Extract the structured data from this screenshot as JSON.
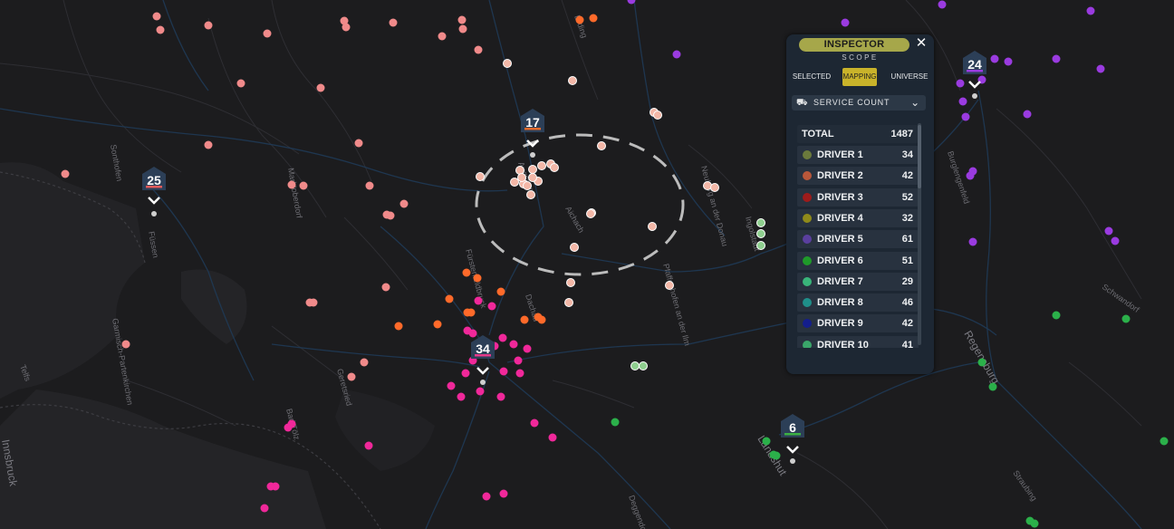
{
  "map": {
    "place_labels": [
      {
        "text": "Regensburg",
        "cls": "city"
      },
      {
        "text": "Landshut",
        "cls": "city"
      },
      {
        "text": "Innsbruck",
        "cls": "city"
      },
      {
        "text": "Garmisch-Partenkirchen",
        "cls": "maplabel"
      },
      {
        "text": "Geretsried",
        "cls": "maplabel"
      },
      {
        "text": "Bad Tölz",
        "cls": "maplabel"
      },
      {
        "text": "Fürstenfeldbruck",
        "cls": "maplabel"
      },
      {
        "text": "Dachau",
        "cls": "maplabel"
      },
      {
        "text": "Pfaffenhofen an der Ilm",
        "cls": "maplabel"
      },
      {
        "text": "Ingolstadt",
        "cls": "maplabel"
      },
      {
        "text": "Neuburg an der Donau",
        "cls": "maplabel"
      },
      {
        "text": "Burglengenfeld",
        "cls": "maplabel"
      },
      {
        "text": "Schwandorf",
        "cls": "maplabel"
      },
      {
        "text": "Straubing",
        "cls": "maplabel"
      },
      {
        "text": "Erding",
        "cls": "maplabel"
      },
      {
        "text": "Deggendorf",
        "cls": "maplabel"
      },
      {
        "text": "Aichach",
        "cls": "maplabel"
      },
      {
        "text": "Augsburg",
        "cls": "maplabel"
      },
      {
        "text": "Füssen",
        "cls": "maplabel"
      },
      {
        "text": "Marktoberdorf",
        "cls": "maplabel"
      },
      {
        "text": "Sonthofen",
        "cls": "maplabel"
      },
      {
        "text": "Telfs",
        "cls": "maplabel"
      }
    ],
    "cluster_markers": [
      {
        "count": "25",
        "color": "#e55b5b"
      },
      {
        "count": "17",
        "color": "#e66b2c"
      },
      {
        "count": "34",
        "color": "#e6398a"
      },
      {
        "count": "6",
        "color": "#3cb043"
      },
      {
        "count": "24",
        "color": "#9a3be0"
      }
    ],
    "marker_icon": "chevron-down-icon",
    "selection_ring": "dashed-circle"
  },
  "inspector": {
    "title": "INSPECTOR",
    "scope_label": "SCOPE",
    "close_icon": "close-icon",
    "tabs": [
      {
        "label": "SELECTED",
        "active": false
      },
      {
        "label": "MAPPING",
        "active": true
      },
      {
        "label": "UNIVERSE",
        "active": false
      }
    ],
    "metric": {
      "label": "SERVICE COUNT",
      "icon": "truck-icon",
      "dropdown_icon": "chevron-down-icon"
    },
    "total": {
      "label": "TOTAL",
      "value": "1487"
    },
    "drivers": [
      {
        "name": "DRIVER 1",
        "value": "34",
        "color": "#6b7a3c"
      },
      {
        "name": "DRIVER 2",
        "value": "42",
        "color": "#b8573a"
      },
      {
        "name": "DRIVER 3",
        "value": "52",
        "color": "#9e1b1b"
      },
      {
        "name": "DRIVER 4",
        "value": "32",
        "color": "#8f8a1a"
      },
      {
        "name": "DRIVER 5",
        "value": "61",
        "color": "#5a3f9e"
      },
      {
        "name": "DRIVER 6",
        "value": "51",
        "color": "#1f9a2a"
      },
      {
        "name": "DRIVER 7",
        "value": "29",
        "color": "#39b57a"
      },
      {
        "name": "DRIVER 8",
        "value": "46",
        "color": "#1f8f8a"
      },
      {
        "name": "DRIVER 9",
        "value": "42",
        "color": "#141e8c"
      },
      {
        "name": "DRIVER 10",
        "value": "41",
        "color": "#3aa66a"
      }
    ]
  }
}
